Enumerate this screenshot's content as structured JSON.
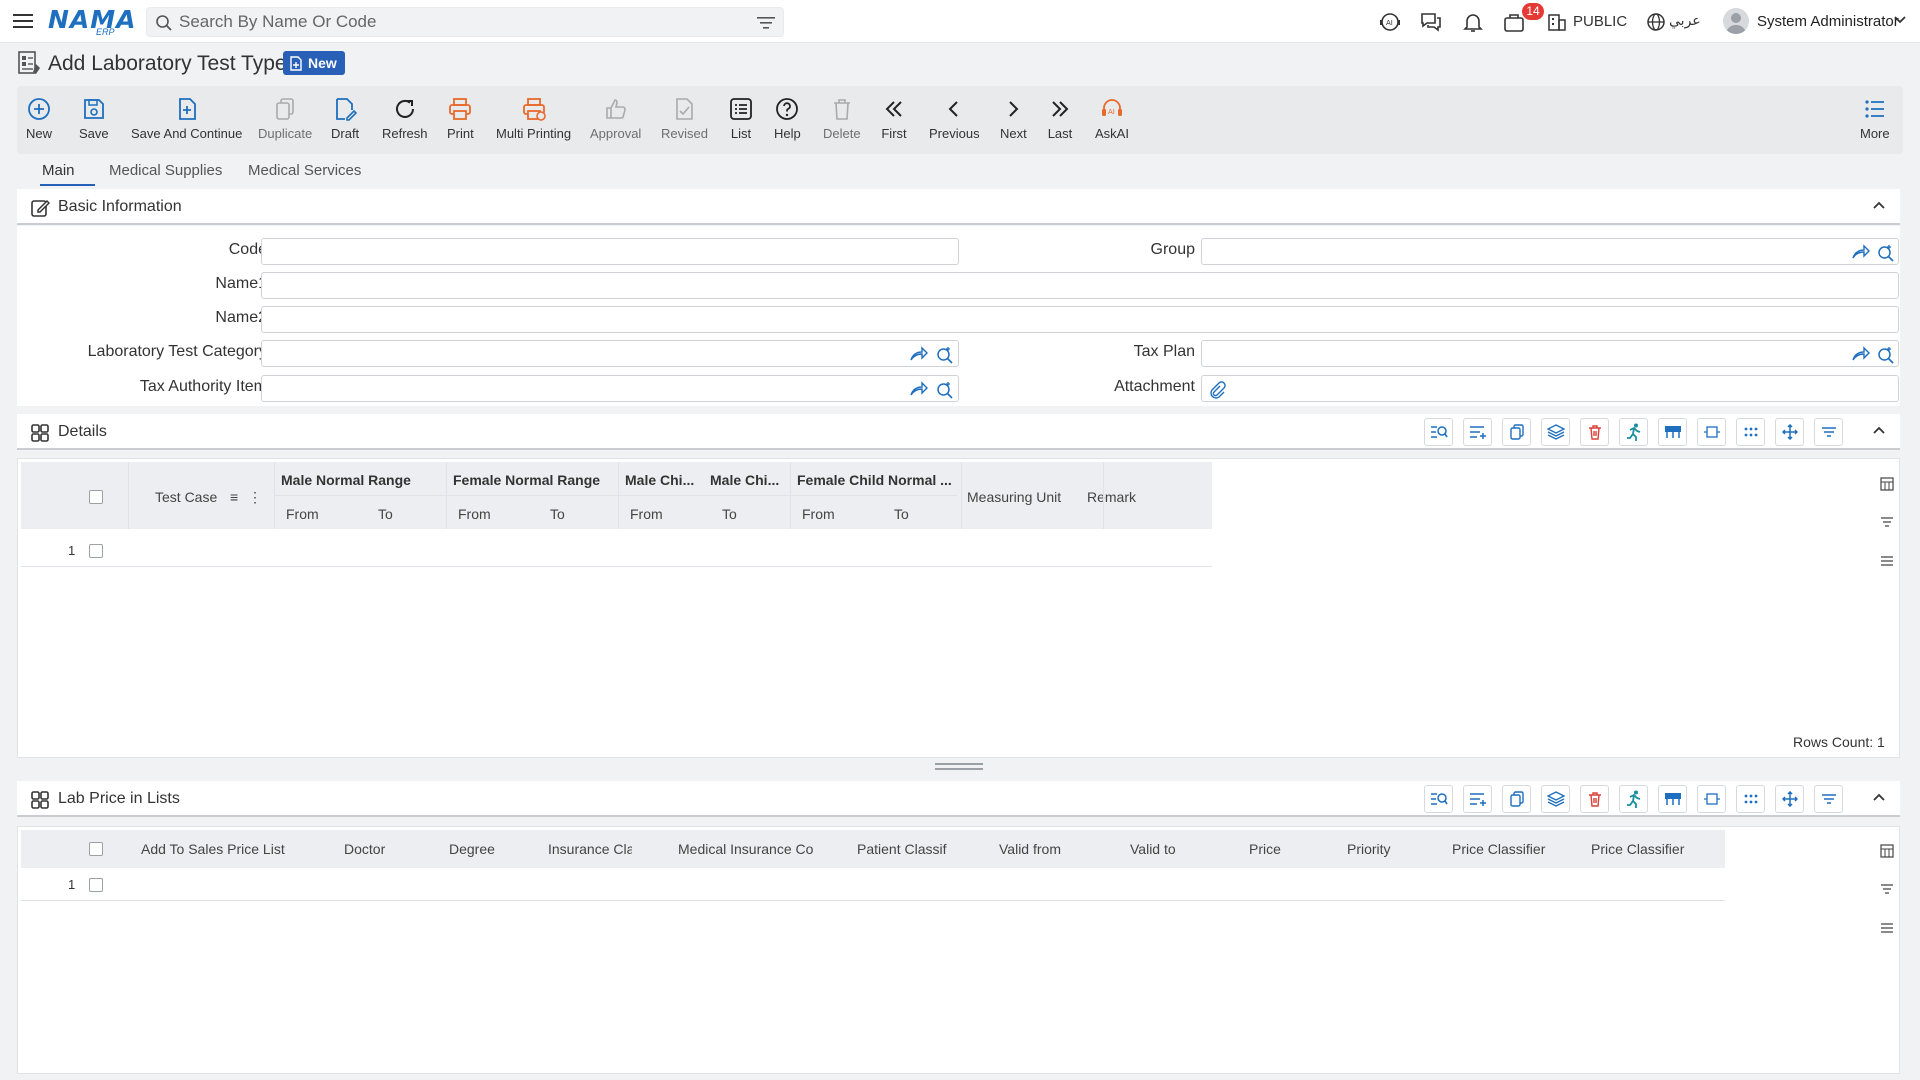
{
  "header": {
    "logo_main": "NAMA",
    "logo_sub": "ERP",
    "search_placeholder": "Search By Name Or Code",
    "notification_count": "14",
    "public_label": "PUBLIC",
    "language_label": "عربي",
    "user_name": "System Administrator"
  },
  "page": {
    "title": "Add Laboratory Test Type",
    "status_badge": "New"
  },
  "toolbar": {
    "new": "New",
    "save": "Save",
    "save_continue": "Save And Continue",
    "duplicate": "Duplicate",
    "draft": "Draft",
    "refresh": "Refresh",
    "print": "Print",
    "multi_printing": "Multi Printing",
    "approval": "Approval",
    "revised": "Revised",
    "list": "List",
    "help": "Help",
    "delete": "Delete",
    "first": "First",
    "previous": "Previous",
    "next": "Next",
    "last": "Last",
    "askai": "AskAI",
    "more": "More"
  },
  "tabs": {
    "main": "Main",
    "medical_supplies": "Medical Supplies",
    "medical_services": "Medical Services"
  },
  "basic_info": {
    "title": "Basic Information",
    "labels": {
      "code": "Code",
      "group": "Group",
      "name1": "Name1",
      "name2": "Name2",
      "lab_test_category": "Laboratory Test Category",
      "tax_plan": "Tax Plan",
      "tax_authority_item": "Tax Authority Item",
      "attachment": "Attachment"
    },
    "values": {
      "code": "",
      "group": "",
      "name1": "",
      "name2": "",
      "lab_test_category": "",
      "tax_plan": "",
      "tax_authority_item": "",
      "attachment": ""
    }
  },
  "details": {
    "title": "Details",
    "columns": {
      "test_case": "Test Case",
      "male_normal_range": "Male Normal Range",
      "female_normal_range": "Female Normal Range",
      "male_child_1": "Male Chi...",
      "male_child_2": "Male Chi...",
      "female_child_normal": "Female Child Normal ...",
      "measuring_unit": "Measuring Unit",
      "remark": "Remark",
      "from": "From",
      "to": "To"
    },
    "rows": [
      "1"
    ],
    "rows_count_label": "Rows Count: 1"
  },
  "lab_price": {
    "title": "Lab Price in Lists",
    "columns": {
      "add_to_sales_price_list": "Add To Sales Price List",
      "doctor": "Doctor",
      "degree": "Degree",
      "insurance_class": "Insurance Cla",
      "medical_insurance": "Medical Insurance Co",
      "patient_classif": "Patient Classif",
      "valid_from": "Valid from",
      "valid_to": "Valid to",
      "price": "Price",
      "priority": "Priority",
      "price_classifier_1": "Price Classifier",
      "price_classifier_2": "Price Classifier"
    },
    "rows": [
      "1"
    ]
  },
  "colors": {
    "accent": "#2860b8",
    "icon_blue": "#1e6fbf",
    "print_orange": "#e8692c",
    "delete_red": "#d9403a",
    "teal": "#178f9e"
  }
}
